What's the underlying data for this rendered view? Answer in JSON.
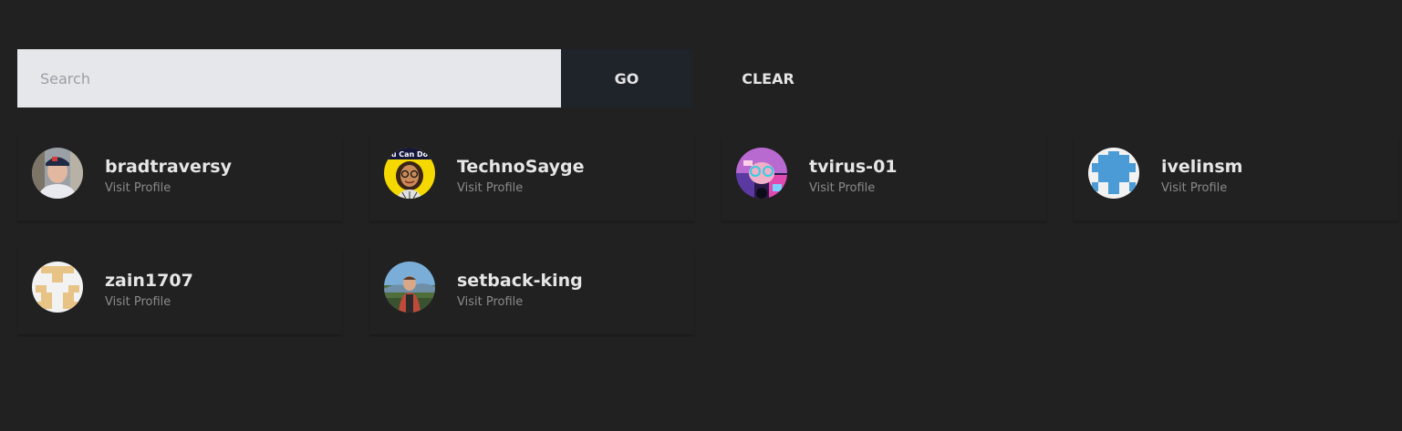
{
  "search": {
    "placeholder": "Search",
    "value": "",
    "go_label": "GO",
    "clear_label": "CLEAR"
  },
  "users": [
    {
      "name": "bradtraversy",
      "link_label": "Visit Profile",
      "avatar": "photo-avatar"
    },
    {
      "name": "TechnoSayge",
      "link_label": "Visit Profile",
      "avatar": "cartoon-avatar",
      "avatar_caption": "u Can Do"
    },
    {
      "name": "tvirus-01",
      "link_label": "Visit Profile",
      "avatar": "illustrated-avatar"
    },
    {
      "name": "ivelinsm",
      "link_label": "Visit Profile",
      "avatar": "identicon-avatar",
      "avatar_color": "#4a9bd6"
    },
    {
      "name": "zain1707",
      "link_label": "Visit Profile",
      "avatar": "identicon-avatar",
      "avatar_color": "#e8c386"
    },
    {
      "name": "setback-king",
      "link_label": "Visit Profile",
      "avatar": "photo-avatar"
    }
  ],
  "colors": {
    "background": "#212121",
    "search_input": "#e6e7ea",
    "go_button": "#1f242b",
    "text_primary": "#e6e6e6",
    "text_muted": "#8a8a8a"
  }
}
